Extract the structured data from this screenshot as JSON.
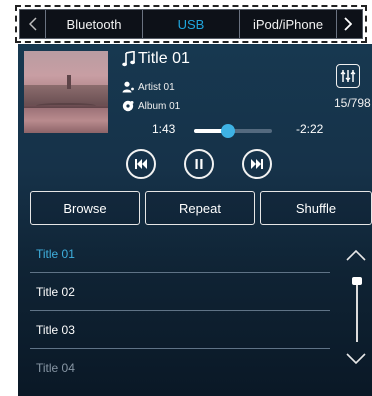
{
  "tabs": {
    "items": [
      {
        "label": "Bluetooth"
      },
      {
        "label": "USB"
      },
      {
        "label": "iPod/iPhone"
      }
    ],
    "active_color": "#1fa6de",
    "left_icon": "chevron-left-icon",
    "right_icon": "chevron-right-icon"
  },
  "now_playing": {
    "title": "Title 01",
    "artist": "Artist 01",
    "album": "Album 01",
    "track_counter": "15/798",
    "elapsed": "1:43",
    "remaining": "-2:22",
    "progress_fraction": 0.44,
    "accent_color": "#3eb2e4"
  },
  "controls": {
    "prev_icon": "skip-previous-icon",
    "pause_icon": "pause-icon",
    "next_icon": "skip-next-icon",
    "eq_icon": "equalizer-icon"
  },
  "actions": {
    "browse": "Browse",
    "repeat": "Repeat",
    "shuffle": "Shuffle"
  },
  "playlist": {
    "items": [
      {
        "title": "Title 01",
        "state": "active"
      },
      {
        "title": "Title 02",
        "state": "normal"
      },
      {
        "title": "Title 03",
        "state": "normal"
      },
      {
        "title": "Title 04",
        "state": "faded"
      }
    ],
    "scroll_up_icon": "chevron-up-icon",
    "scroll_down_icon": "chevron-down-icon"
  }
}
